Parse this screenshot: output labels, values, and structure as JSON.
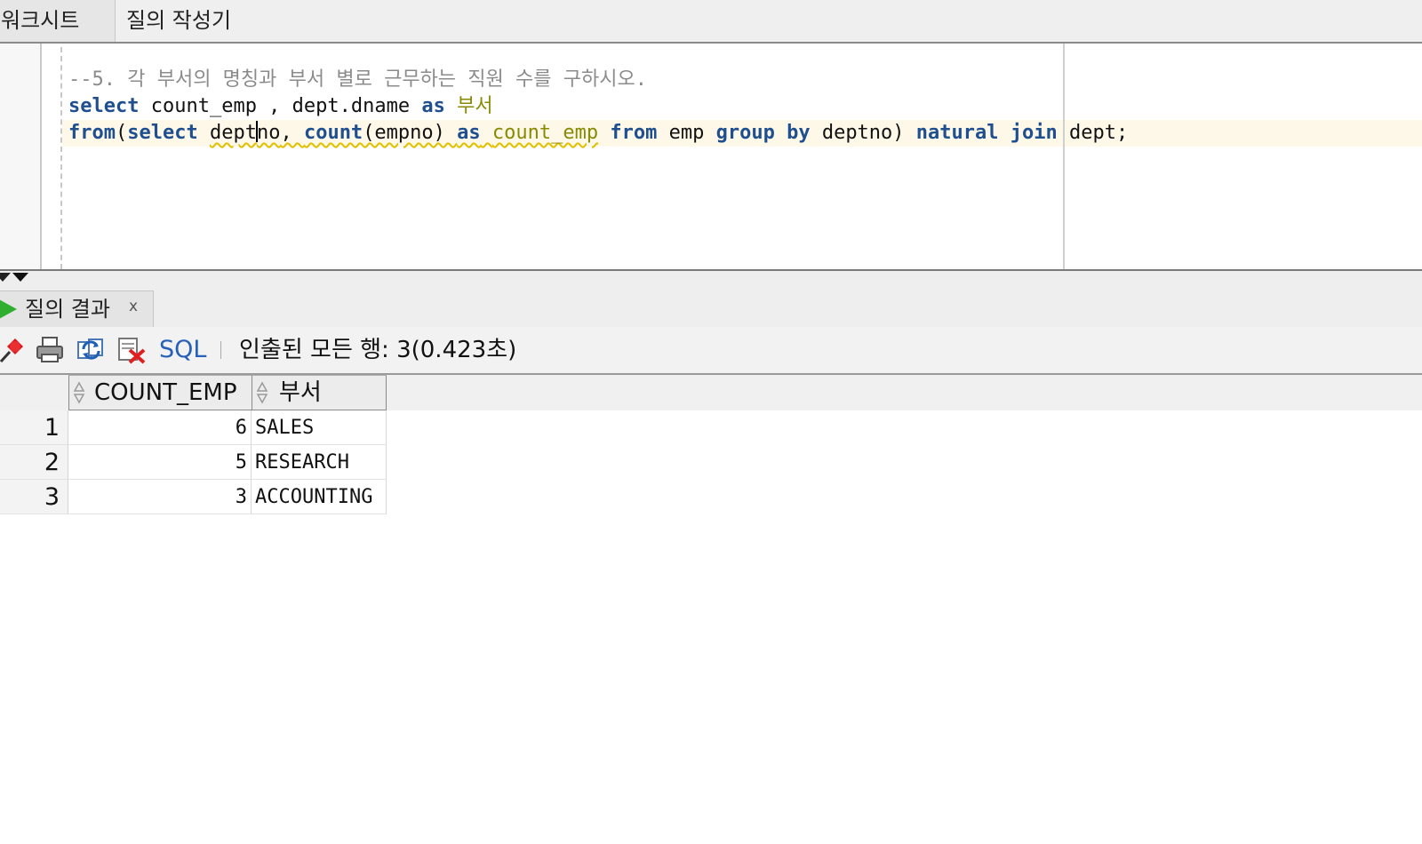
{
  "top_tabs": {
    "worksheet": "워크시트",
    "query_builder": "질의 작성기"
  },
  "editor": {
    "comment_line": "--5. 각 부서의 명칭과 부서 별로 근무하는 직원 수를 구하시오.",
    "line2": {
      "kw_select": "select",
      "text1": " count_emp , dept.dname ",
      "kw_as": "as",
      "space": " ",
      "alias": "부서"
    },
    "line3": {
      "kw_from": "from",
      "paren_open": "(",
      "kw_select": "select",
      "space1": " ",
      "deptno_part1": "dept",
      "deptno_part2": "no",
      "comma": ", ",
      "fn_count": "count",
      "args": "(empno) ",
      "kw_as": "as",
      "space2": " ",
      "alias": "count_emp",
      "space3": " ",
      "kw_from2": "from",
      "text_emp": " emp ",
      "kw_group": "group",
      "space4": " ",
      "kw_by": "by",
      "text_deptno": " deptno) ",
      "kw_natural": "natural",
      "space5": " ",
      "kw_join": "join",
      "text_end": " dept;"
    }
  },
  "result_tab": {
    "label": "질의 결과",
    "close_glyph": "x",
    "icon": "play-icon"
  },
  "toolbar": {
    "icons": [
      "pin-icon",
      "print-icon",
      "refresh-icon",
      "cancel-icon"
    ],
    "sql_label": "SQL",
    "status": "인출된 모든 행: 3(0.423초)"
  },
  "grid": {
    "columns": [
      "COUNT_EMP",
      "부서"
    ],
    "rows": [
      {
        "num": "1",
        "count_emp": "6",
        "dept": "SALES"
      },
      {
        "num": "2",
        "count_emp": "5",
        "dept": "RESEARCH"
      },
      {
        "num": "3",
        "count_emp": "3",
        "dept": "ACCOUNTING"
      }
    ]
  },
  "colors": {
    "keyword": "#1f4f8f",
    "alias": "#8a8a00",
    "comment": "#8b8b8b",
    "sql_link": "#2660b8",
    "play_green": "#2fae2f"
  }
}
